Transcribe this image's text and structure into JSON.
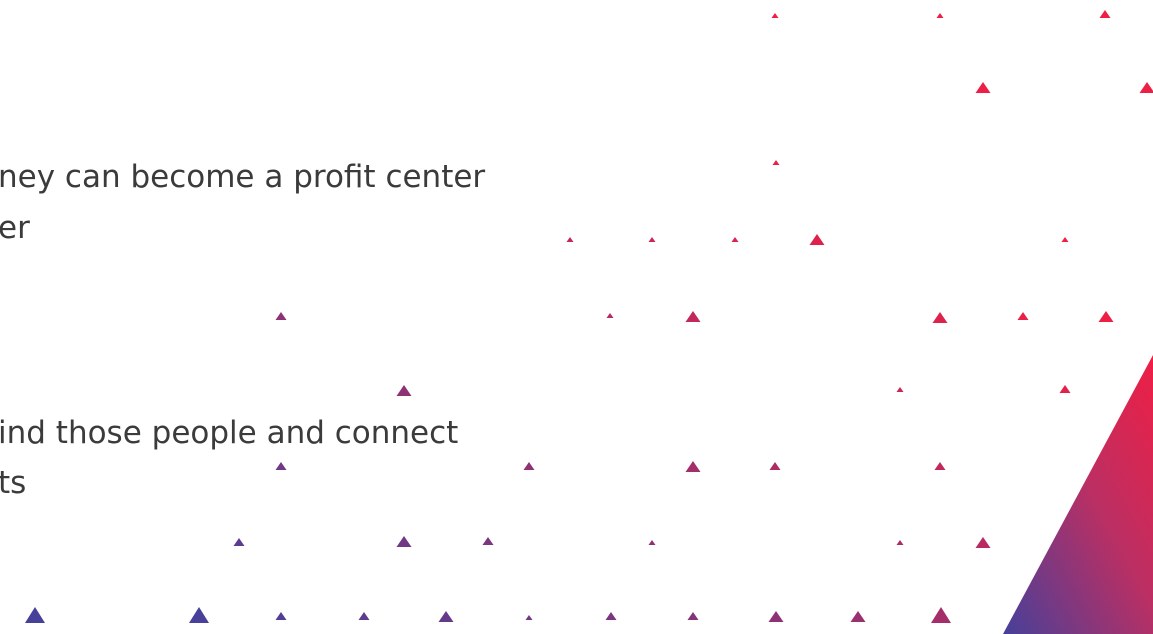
{
  "slide": {
    "text_lines": [
      "ney can become a profit center",
      "er",
      "ind those people and connect",
      "ts"
    ]
  },
  "colors": {
    "background": "#ffffff",
    "text": "#3b3b3b",
    "accent_red": "#ee1f45",
    "accent_blue": "#46409a"
  },
  "decoration": {
    "pattern": "scattered-triangles",
    "gradient": "red-to-indigo"
  }
}
